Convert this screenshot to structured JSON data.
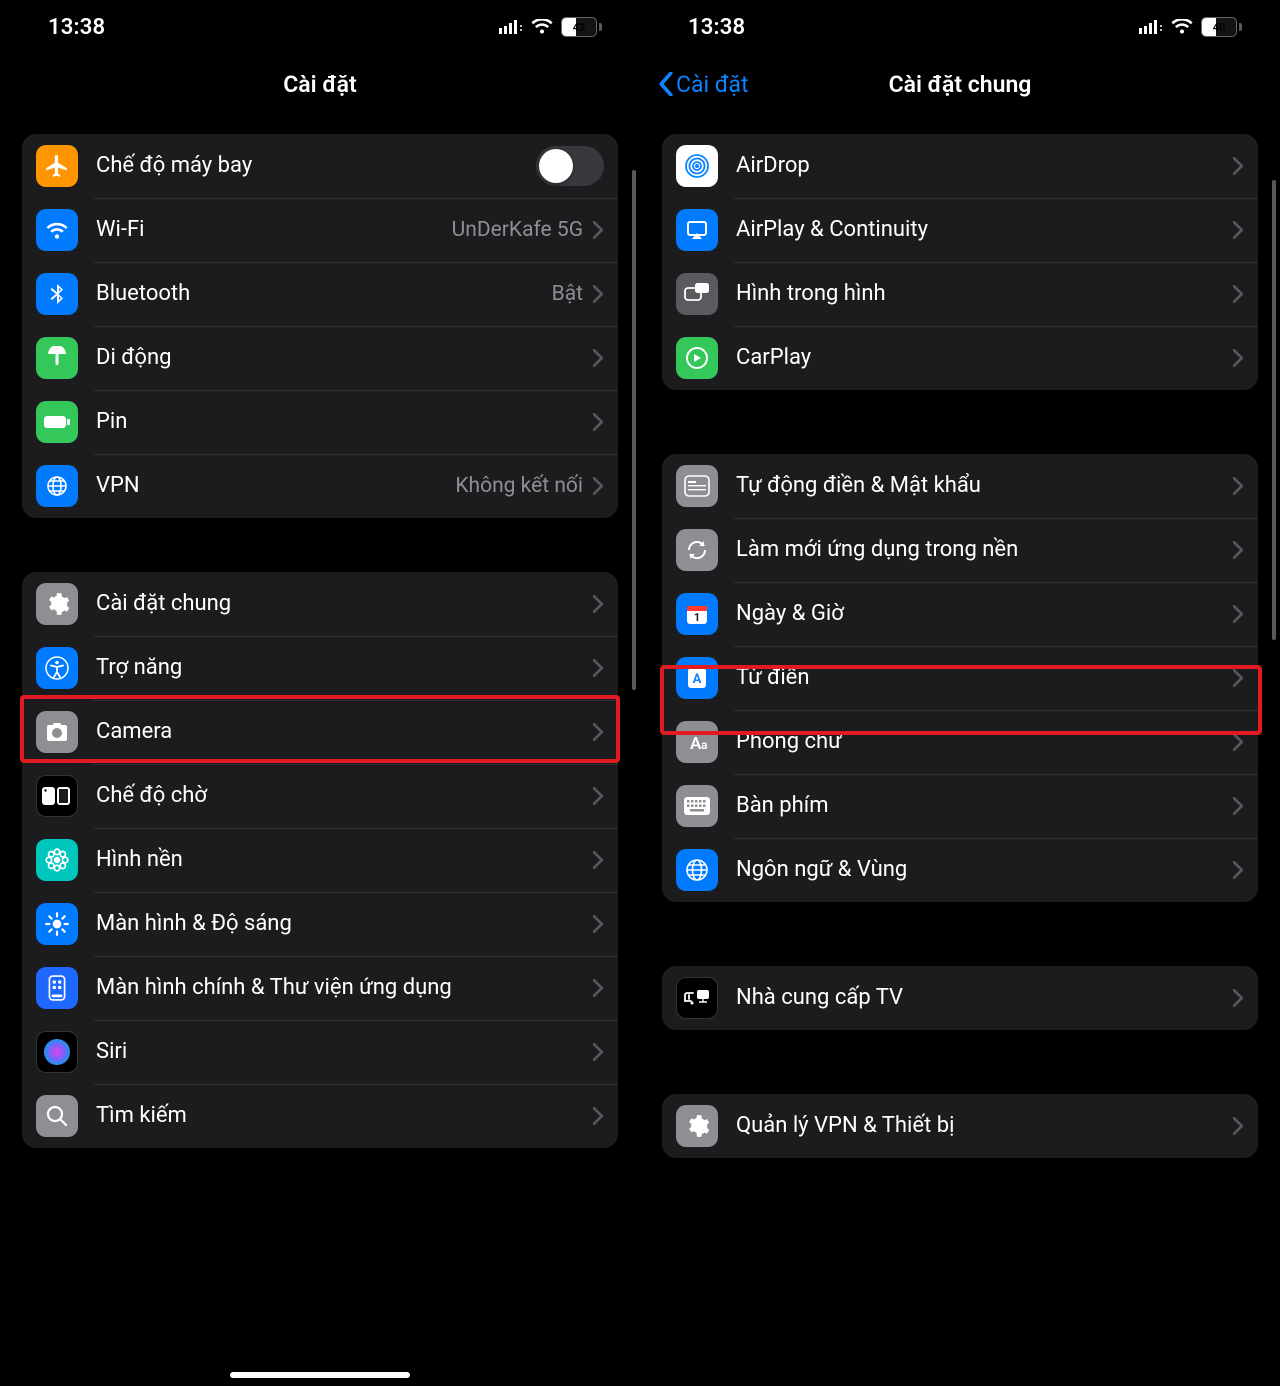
{
  "left": {
    "status": {
      "time": "13:38",
      "battery": "42",
      "battery_pct": 42
    },
    "nav": {
      "title": "Cài đặt"
    },
    "group1": [
      {
        "icon": "airplane",
        "bg": "bg-orange",
        "label": "Chế độ máy bay",
        "switch": true
      },
      {
        "icon": "wifi",
        "bg": "bg-blue",
        "label": "Wi-Fi",
        "detail": "UnDerKafe 5G"
      },
      {
        "icon": "bluetooth",
        "bg": "bg-blue",
        "label": "Bluetooth",
        "detail": "Bật"
      },
      {
        "icon": "cellular",
        "bg": "bg-green",
        "label": "Di động"
      },
      {
        "icon": "battery",
        "bg": "bg-green",
        "label": "Pin"
      },
      {
        "icon": "globe",
        "bg": "bg-blue",
        "label": "VPN",
        "detail": "Không kết nối"
      }
    ],
    "group2": [
      {
        "icon": "gear",
        "bg": "bg-gray",
        "label": "Cài đặt chung",
        "highlight": true
      },
      {
        "icon": "accessibility",
        "bg": "bg-blue",
        "label": "Trợ năng"
      },
      {
        "icon": "camera",
        "bg": "bg-gray",
        "label": "Camera"
      },
      {
        "icon": "standby",
        "bg": "bg-black",
        "label": "Chế độ chờ"
      },
      {
        "icon": "wallpaper",
        "bg": "bg-teal",
        "label": "Hình nền"
      },
      {
        "icon": "brightness",
        "bg": "bg-blue",
        "label": "Màn hình & Độ sáng"
      },
      {
        "icon": "homescreen",
        "bg": "bg-navy",
        "label": "Màn hình chính & Thư viện ứng dụng"
      },
      {
        "icon": "siri",
        "bg": "bg-black",
        "label": "Siri"
      },
      {
        "icon": "search",
        "bg": "bg-gray",
        "label": "Tìm kiếm"
      }
    ]
  },
  "right": {
    "status": {
      "time": "13:38",
      "battery": "40",
      "battery_pct": 40
    },
    "nav": {
      "back": "Cài đặt",
      "title": "Cài đặt chung"
    },
    "group1": [
      {
        "icon": "airdrop",
        "bg": "bg-white",
        "label": "AirDrop"
      },
      {
        "icon": "airplay",
        "bg": "bg-blue",
        "label": "AirPlay & Continuity"
      },
      {
        "icon": "pip",
        "bg": "bg-graydark",
        "label": "Hình trong hình"
      },
      {
        "icon": "carplay",
        "bg": "bg-green",
        "label": "CarPlay"
      }
    ],
    "group2": [
      {
        "icon": "autofill",
        "bg": "bg-gray",
        "label": "Tự động điền & Mật khẩu"
      },
      {
        "icon": "refresh",
        "bg": "bg-gray",
        "label": "Làm mới ứng dụng trong nền",
        "highlight": true
      },
      {
        "icon": "date",
        "bg": "bg-blue",
        "label": "Ngày & Giờ"
      },
      {
        "icon": "dictionary",
        "bg": "bg-blue",
        "label": "Từ điển"
      },
      {
        "icon": "fonts",
        "bg": "bg-gray",
        "label": "Phông chữ"
      },
      {
        "icon": "keyboard",
        "bg": "bg-gray",
        "label": "Bàn phím"
      },
      {
        "icon": "language",
        "bg": "bg-blue",
        "label": "Ngôn ngữ & Vùng"
      }
    ],
    "group3": [
      {
        "icon": "tvprovider",
        "bg": "bg-black",
        "label": "Nhà cung cấp TV"
      }
    ],
    "group4": [
      {
        "icon": "vpndevice",
        "bg": "bg-gray",
        "label": "Quản lý VPN & Thiết bị"
      }
    ]
  }
}
